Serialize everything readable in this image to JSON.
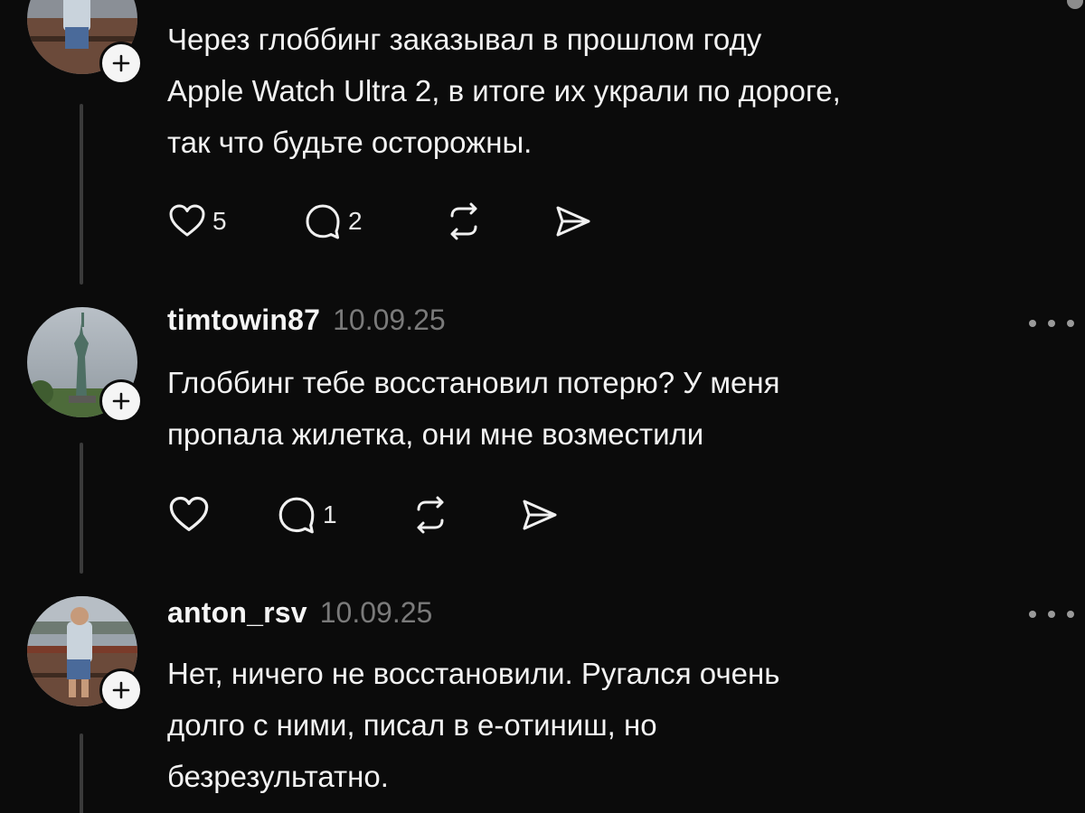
{
  "comments": [
    {
      "username": "",
      "date": "",
      "lines": [
        "Через глоббинг заказывал в прошлом году",
        "Apple Watch Ultra 2, в итоге их украли по дороге,",
        "так что будьте осторожны."
      ],
      "likes": "5",
      "replies": "2"
    },
    {
      "username": "timtowin87",
      "date": "10.09.25",
      "lines": [
        "Глоббинг тебе восстановил потерю? У меня",
        "пропала жилетка, они мне возместили"
      ],
      "likes": "",
      "replies": "1"
    },
    {
      "username": "anton_rsv",
      "date": "10.09.25",
      "lines": [
        "Нет, ничего не восстановили. Ругался очень",
        "долго с ними, писал в е-отиниш, но",
        "безрезультатно."
      ]
    }
  ],
  "icons": {
    "like": "heart-icon",
    "reply": "comment-bubble-icon",
    "repost": "repost-icon",
    "share": "send-icon",
    "follow": "plus-icon",
    "more": "more-dots-icon"
  },
  "colors": {
    "background": "#0b0b0b",
    "text": "#f2f2f2",
    "muted": "#7a7a7a",
    "thread_line": "#3a3a3a"
  }
}
